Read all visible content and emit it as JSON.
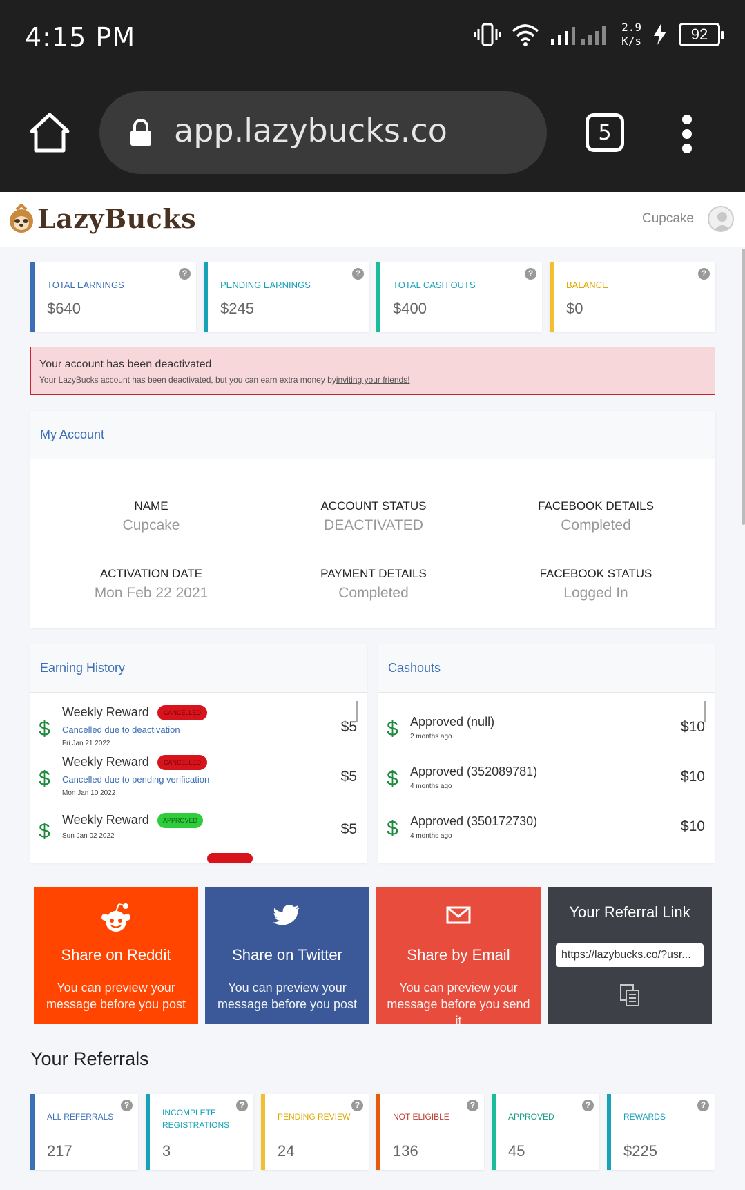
{
  "status_bar": {
    "time": "4:15 PM",
    "speed_value": "2.9",
    "speed_unit": "K/s",
    "battery": "92"
  },
  "browser": {
    "url": "app.lazybucks.co",
    "tab_count": "5"
  },
  "header": {
    "logo_text": "LazyBucks",
    "user_name": "Cupcake"
  },
  "stats": [
    {
      "label": "TOTAL EARNINGS",
      "value": "$640",
      "color": "#3b6fb6"
    },
    {
      "label": "PENDING EARNINGS",
      "value": "$245",
      "color": "#17a2b8"
    },
    {
      "label": "TOTAL CASH OUTS",
      "value": "$400",
      "color": "#1abc9c"
    },
    {
      "label": "BALANCE",
      "value": "$0",
      "color": "#f0c030"
    }
  ],
  "alert": {
    "title": "Your account has been deactivated",
    "message": "Your LazyBucks account has been deactivated, but you can earn extra money by",
    "link": "inviting your friends!"
  },
  "account": {
    "title": "My Account",
    "fields": [
      {
        "label": "NAME",
        "value": "Cupcake"
      },
      {
        "label": "ACCOUNT STATUS",
        "value": "DEACTIVATED"
      },
      {
        "label": "FACEBOOK DETAILS",
        "value": "Completed"
      },
      {
        "label": "ACTIVATION DATE",
        "value": "Mon Feb 22 2021"
      },
      {
        "label": "PAYMENT DETAILS",
        "value": "Completed"
      },
      {
        "label": "FACEBOOK STATUS",
        "value": "Logged In"
      }
    ]
  },
  "earning_history": {
    "title": "Earning History",
    "rows": [
      {
        "title": "Weekly Reward",
        "badge": "CANCELLED",
        "sub": "Cancelled due to deactivation",
        "date": "Fri Jan 21 2022",
        "amount": "$5"
      },
      {
        "title": "Weekly Reward",
        "badge": "CANCELLED",
        "sub": "Cancelled due to pending verification",
        "date": "Mon Jan 10 2022",
        "amount": "$5"
      },
      {
        "title": "Weekly Reward",
        "badge": "APPROVED",
        "sub": "",
        "date": "Sun Jan 02 2022",
        "amount": "$5"
      }
    ]
  },
  "cashouts": {
    "title": "Cashouts",
    "rows": [
      {
        "title": "Approved (null)",
        "date": "2 months ago",
        "amount": "$10"
      },
      {
        "title": "Approved (352089781)",
        "date": "4 months ago",
        "amount": "$10"
      },
      {
        "title": "Approved (350172730)",
        "date": "4 months ago",
        "amount": "$10"
      }
    ]
  },
  "share": {
    "reddit": {
      "title": "Share on Reddit",
      "desc": "You can preview your message before you post",
      "color": "#ff4500"
    },
    "twitter": {
      "title": "Share on Twitter",
      "desc": "You can preview your message before you post",
      "color": "#3b5998"
    },
    "email": {
      "title": "Share by Email",
      "desc": "You can preview your message before you send it",
      "color": "#e74c3c"
    },
    "referral": {
      "title": "Your Referral Link",
      "link": "https://lazybucks.co/?usr...",
      "color": "#3d4047"
    }
  },
  "referrals": {
    "title": "Your Referrals",
    "stats": [
      {
        "label": "ALL REFERRALS",
        "value": "217",
        "color": "#3b6fb6"
      },
      {
        "label": "INCOMPLETE REGISTRATIONS",
        "value": "3",
        "color": "#17a2b8"
      },
      {
        "label": "PENDING REVIEW",
        "value": "24",
        "color": "#f0c030"
      },
      {
        "label": "NOT ELIGIBLE",
        "value": "136",
        "color": "#e8590c"
      },
      {
        "label": "APPROVED",
        "value": "45",
        "color": "#1abc9c"
      },
      {
        "label": "REWARDS",
        "value": "$225",
        "color": "#17a2b8"
      }
    ]
  }
}
